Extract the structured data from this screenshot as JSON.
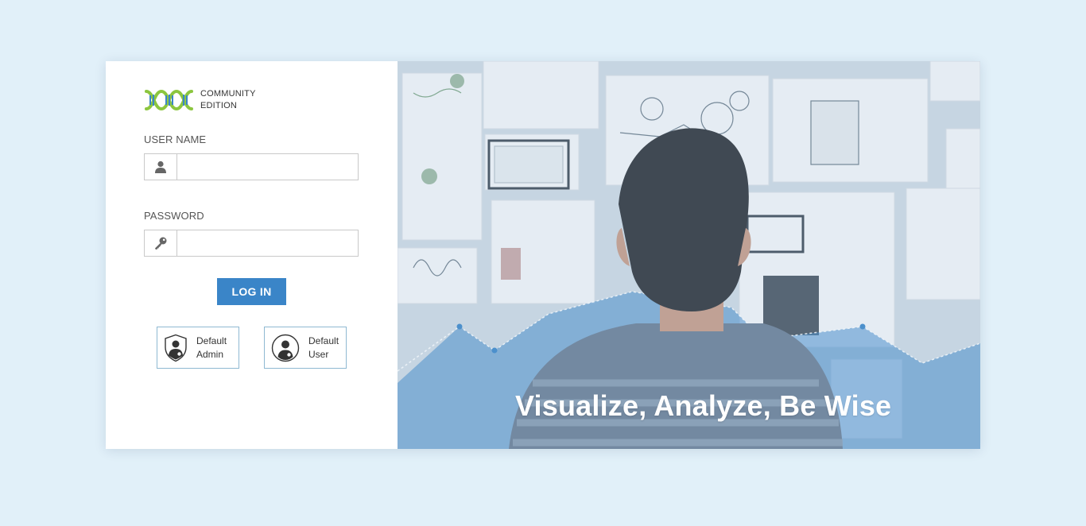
{
  "logo": {
    "line1": "COMMUNITY",
    "line2": "EDITION"
  },
  "form": {
    "username_label": "USER NAME",
    "username_value": "",
    "password_label": "PASSWORD",
    "password_value": "",
    "login_label": "LOG IN"
  },
  "defaults": {
    "admin": {
      "line1": "Default",
      "line2": "Admin"
    },
    "user": {
      "line1": "Default",
      "line2": "User"
    }
  },
  "hero": {
    "tagline": "Visualize, Analyze, Be Wise"
  },
  "colors": {
    "accent": "#3a85c8",
    "background": "#e1f0f9",
    "logo_green": "#8cc63f",
    "logo_blue": "#3a85c8"
  },
  "icons": {
    "username": "user-icon",
    "password": "key-icon",
    "admin": "admin-shield-icon",
    "user": "user-avatar-icon"
  }
}
